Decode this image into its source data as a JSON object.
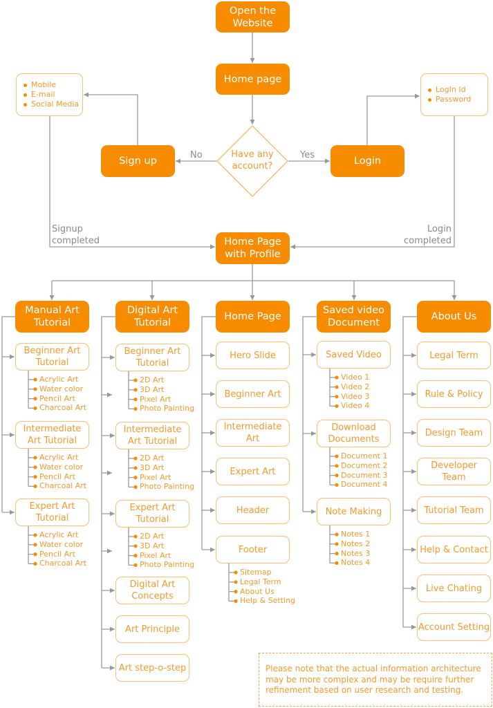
{
  "colors": {
    "accent": "#f78c00",
    "outline": "#fbbe72",
    "text": "#f39a2e",
    "connector": "#999999"
  },
  "top": {
    "open_website": "Open the Website",
    "home_page": "Home page",
    "decision": "Have any account?",
    "no_label": "No",
    "yes_label": "Yes",
    "signup": "Sign up",
    "login": "Login",
    "signup_options": [
      "Mobile",
      "E-mail",
      "Social Media"
    ],
    "login_fields": [
      "LogIn Id",
      "Password"
    ],
    "signup_completed": "Signup completed",
    "login_completed": "Login completed",
    "home_profile": "Home Page with Profile"
  },
  "columns": [
    {
      "title": "Manual Art Tutorial",
      "children": [
        {
          "label": "Beginner Art Tutorial",
          "items": [
            "Acrylic Art",
            "Water color",
            "Pencil Art",
            "Charcoal Art"
          ]
        },
        {
          "label": "Intermediate Art Tutorial",
          "items": [
            "Acrylic Art",
            "Water color",
            "Pencil Art",
            "Charcoal Art"
          ]
        },
        {
          "label": "Expert Art Tutorial",
          "items": [
            "Acrylic Art",
            "Water color",
            "Pencil Art",
            "Charcoal Art"
          ]
        }
      ]
    },
    {
      "title": "Digital Art Tutorial",
      "children": [
        {
          "label": "Beginner Art Tutorial",
          "items": [
            "2D Art",
            "3D Art",
            "Pixel Art",
            "Photo Painting"
          ]
        },
        {
          "label": "Intermediate Art Tutorial",
          "items": [
            "2D Art",
            "3D Art",
            "Pixel Art",
            "Photo Painting"
          ]
        },
        {
          "label": "Expert Art Tutorial",
          "items": [
            "2D Art",
            "3D Art",
            "Pixel Art",
            "Photo Painting"
          ]
        },
        {
          "label": "Digital Art Concepts",
          "items": []
        },
        {
          "label": "Art Principle",
          "items": []
        },
        {
          "label": "Art step-o-step",
          "items": []
        }
      ]
    },
    {
      "title": "Home Page",
      "children": [
        {
          "label": "Hero Slide",
          "items": []
        },
        {
          "label": "Beginner Art",
          "items": []
        },
        {
          "label": "Intermediate Art",
          "items": []
        },
        {
          "label": "Expert Art",
          "items": []
        },
        {
          "label": "Header",
          "items": []
        },
        {
          "label": "Footer",
          "items": [
            "Sitemap",
            "Legal Term",
            "About Us",
            "Help & Setting"
          ]
        }
      ]
    },
    {
      "title": "Saved video Document",
      "children": [
        {
          "label": "Saved Video",
          "items": [
            "Video 1",
            "Video 2",
            "Video 3",
            "Video 4"
          ]
        },
        {
          "label": "Download Documents",
          "items": [
            "Document 1",
            "Document 2",
            "Document 3",
            "Document 4"
          ]
        },
        {
          "label": "Note Making",
          "items": [
            "Notes 1",
            "Notes 2",
            "Notes 3",
            "Notes 4"
          ]
        }
      ]
    },
    {
      "title": "About Us",
      "children": [
        {
          "label": "Legal Term",
          "items": []
        },
        {
          "label": "Rule & Policy",
          "items": []
        },
        {
          "label": "Design Team",
          "items": []
        },
        {
          "label": "Developer Team",
          "items": []
        },
        {
          "label": "Tutorial Team",
          "items": []
        },
        {
          "label": "Help & Contact",
          "items": []
        },
        {
          "label": "Live Chating",
          "items": []
        },
        {
          "label": "Account Setting",
          "items": []
        }
      ]
    }
  ],
  "note": "Please note that the actual information architecture may be more complex  and may be  require  further refinement based on user research and testing."
}
